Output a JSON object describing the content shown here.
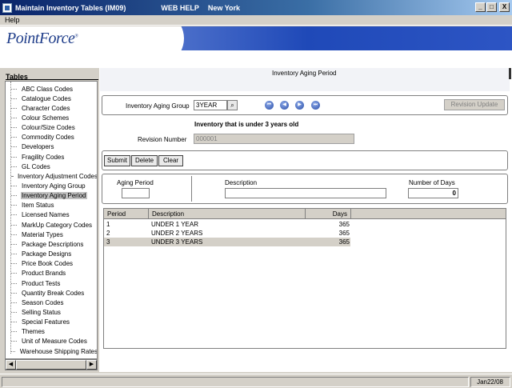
{
  "window": {
    "title": "Maintain Inventory Tables (IM09)",
    "web_help": "WEB HELP",
    "location": "New York",
    "btn_min": "_",
    "btn_max": "□",
    "btn_close": "X"
  },
  "menu": {
    "help": "Help"
  },
  "brand": {
    "logo": "PointForce"
  },
  "sidebar": {
    "heading": "Tables",
    "items": [
      "ABC Class Codes",
      "Catalogue Codes",
      "Character Codes",
      "Colour Schemes",
      "Colour/Size Codes",
      "Commodity Codes",
      "Developers",
      "Fragility Codes",
      "GL Codes",
      "Inventory Adjustment Codes",
      "Inventory Aging Group",
      "Inventory Aging Period",
      "Item Status",
      "Licensed Names",
      "MarkUp Category Codes",
      "Material Types",
      "Package Descriptions",
      "Package Designs",
      "Price Book Codes",
      "Product Brands",
      "Product Tests",
      "Quantity Break Codes",
      "Season Codes",
      "Selling Status",
      "Special Features",
      "Themes",
      "Unit of Measure Codes",
      "Warehouse Shipping Rates"
    ],
    "selected_item": "Inventory Aging Period",
    "scroll_left": "◀",
    "scroll_right": "▶"
  },
  "main": {
    "page_title": "Inventory Aging Period",
    "aging_group_label": "Inventory Aging Group",
    "aging_group_value": "3YEAR",
    "lookup_glyph": "⌕",
    "nav": {
      "first": "⏮",
      "prev": "◀",
      "next": "▶",
      "last": "⏭"
    },
    "revision_update": "Revision Update",
    "group_description": "Inventory that is under 3 years old",
    "revision_number_label": "Revision Number",
    "revision_number_value": "000001",
    "actions": {
      "submit": "Submit",
      "delete": "Delete",
      "clear": "Clear"
    },
    "edit": {
      "aging_period_label": "Aging Period",
      "aging_period_value": "",
      "description_label": "Description",
      "description_value": "",
      "days_label": "Number of Days",
      "days_value": "0"
    },
    "grid": {
      "columns": [
        "Period",
        "Description",
        "Days"
      ],
      "rows": [
        {
          "period": "1",
          "description": "UNDER 1 YEAR",
          "days": "365"
        },
        {
          "period": "2",
          "description": "UNDER 2 YEARS",
          "days": "365"
        },
        {
          "period": "3",
          "description": "UNDER 3 YEARS",
          "days": "365"
        }
      ],
      "selected_row": 2
    }
  },
  "statusbar": {
    "date": "Jan22/08"
  }
}
